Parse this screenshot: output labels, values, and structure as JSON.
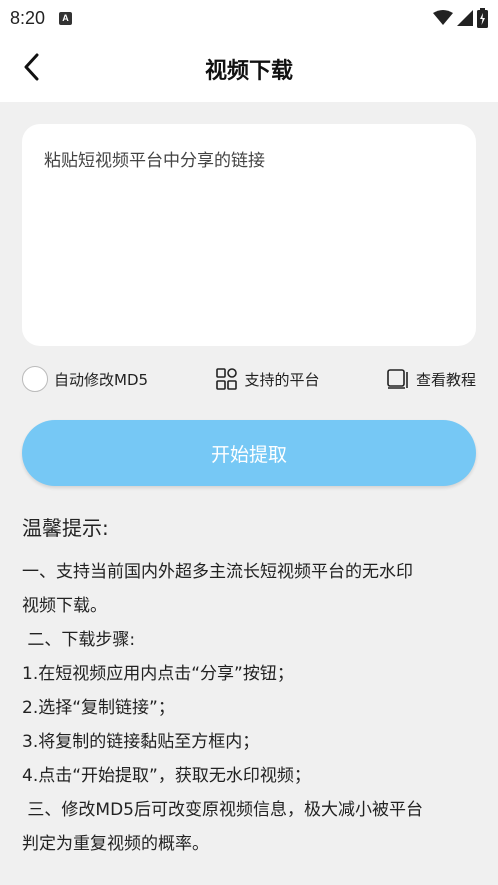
{
  "status_bar": {
    "time": "8:20",
    "notification_icon": "A"
  },
  "header": {
    "title": "视频下载"
  },
  "input": {
    "placeholder": "粘贴短视频平台中分享的链接"
  },
  "options": {
    "modify_md5_label": "自动修改MD5",
    "platforms_label": "支持的平台",
    "tutorial_label": "查看教程"
  },
  "start_button": {
    "label": "开始提取"
  },
  "tips": {
    "title": "温馨提示:",
    "lines": [
      "一、支持当前国内外超多主流长短视频平台的无水印",
      "视频下载。",
      " 二、下载步骤:",
      "1.在短视频应用内点击“分享”按钮；",
      "2.选择“复制链接”；",
      "3.将复制的链接黏贴至方框内；",
      "4.点击“开始提取”，获取无水印视频；",
      " 三、修改MD5后可改变原视频信息，极大减小被平台",
      "判定为重复视频的概率。"
    ]
  },
  "colors": {
    "accent": "#76c8f5",
    "background": "#f0f0f0"
  }
}
